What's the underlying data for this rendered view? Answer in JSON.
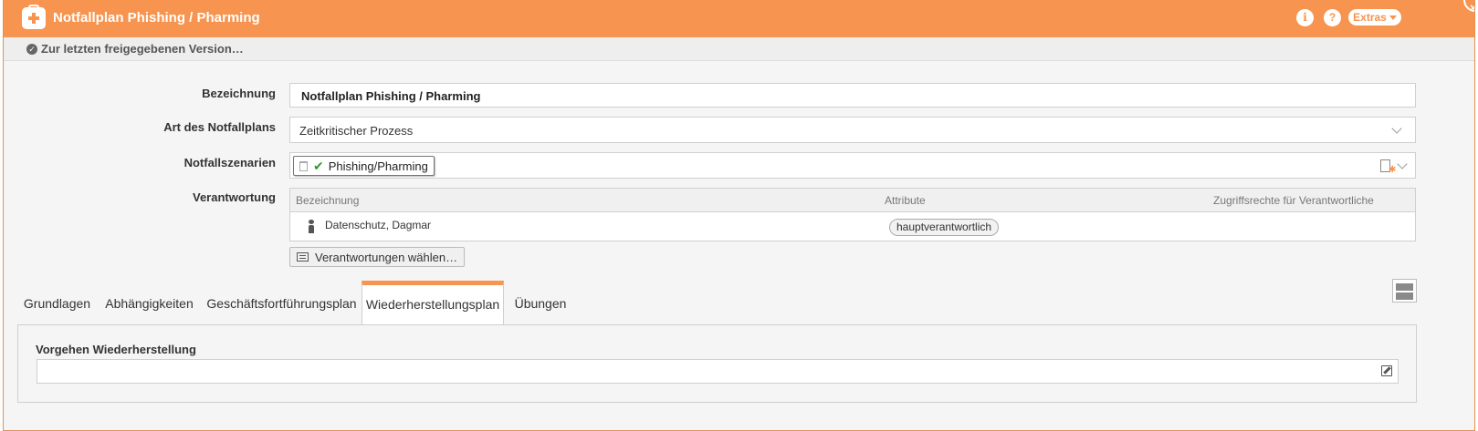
{
  "window": {
    "title": "Notfallplan Phishing / Pharming",
    "info_icon_glyph": "i",
    "help_icon_glyph": "?",
    "extras_label": "Extras",
    "close_glyph": "×"
  },
  "version_bar": {
    "link_label": "Zur letzten freigegebenen Version…"
  },
  "form": {
    "bezeichnung_label": "Bezeichnung",
    "bezeichnung_value": "Notfallplan Phishing / Pharming",
    "art_label": "Art des Notfallplans",
    "art_value": "Zeitkritischer Prozess",
    "szenarien_label": "Notfallszenarien",
    "szenarien_tag": "Phishing/Pharming",
    "verantwortung_label": "Verantwortung"
  },
  "resp_table": {
    "headers": [
      "Bezeichnung",
      "Attribute",
      "Zugriffsrechte für Verantwortliche"
    ],
    "rows": [
      {
        "name": "Datenschutz, Dagmar",
        "attribute": "hauptverantwortlich",
        "rights": ""
      }
    ],
    "choose_button": "Verantwortungen wählen…"
  },
  "tabs": [
    {
      "label": "Grundlagen",
      "active": false
    },
    {
      "label": "Abhängigkeiten",
      "active": false
    },
    {
      "label": "Geschäftsfortführungsplan",
      "active": false
    },
    {
      "label": "Wiederherstellungsplan",
      "active": true
    },
    {
      "label": "Übungen",
      "active": false
    }
  ],
  "panel": {
    "field_label": "Vorgehen Wiederherstellung",
    "field_value": ""
  },
  "colors": {
    "accent": "#f7944f",
    "check_green": "#2e9c2e"
  },
  "icons": [
    "first-aid-kit-icon",
    "info-icon",
    "help-icon",
    "close-icon",
    "check-circle-icon",
    "chevron-down-icon",
    "trash-icon",
    "check-icon",
    "new-document-icon",
    "person-icon",
    "list-icon",
    "layout-toggle-icon",
    "edit-icon"
  ]
}
